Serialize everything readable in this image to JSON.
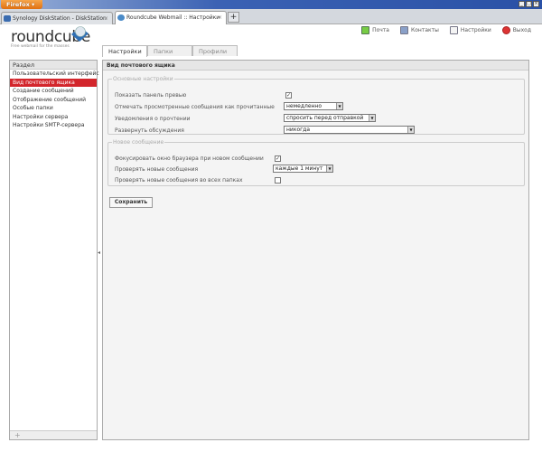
{
  "browser": {
    "menu_label": "Firefox",
    "tabs": [
      {
        "title": "Synology DiskStation - DiskStation"
      },
      {
        "title": "Roundcube Webmail :: Настройки"
      }
    ],
    "new_tab": "+"
  },
  "logo": {
    "name": "roundcube",
    "tagline": "Free webmail for the masses"
  },
  "topnav": [
    {
      "label": "Почта",
      "icon": "mail-icon"
    },
    {
      "label": "Контакты",
      "icon": "contacts-icon"
    },
    {
      "label": "Настройки",
      "icon": "settings-icon"
    },
    {
      "label": "Выход",
      "icon": "logout-icon"
    }
  ],
  "settings_tabs": [
    {
      "label": "Настройки",
      "active": true
    },
    {
      "label": "Папки"
    },
    {
      "label": "Профили"
    }
  ],
  "sections": {
    "header": "Раздел",
    "items": [
      "Пользовательский интерфейс",
      "Вид почтового ящика",
      "Создание сообщений",
      "Отображение сообщений",
      "Особые папки",
      "Настройки сервера",
      "Настройки SMTP-сервера"
    ],
    "selected": 1,
    "add": "+"
  },
  "main": {
    "title": "Вид почтового ящика",
    "group1": {
      "legend": "Основные настройки",
      "preview_label": "Показать панель превью",
      "preview_checked": true,
      "mark_read_label": "Отмечать просмотренные сообщения как прочитанные",
      "mark_read_value": "немедленно",
      "receipts_label": "Уведомления о прочтении",
      "receipts_value": "спросить перед отправкой",
      "threads_label": "Развернуть обсуждения",
      "threads_value": "никогда"
    },
    "group2": {
      "legend": "Новое сообщение",
      "focus_label": "Фокусировать окно браузера при новом сообщении",
      "focus_checked": true,
      "check_label": "Проверять новые сообщения",
      "check_value": "каждые 1 минут",
      "check_all_label": "Проверять новые сообщения во всех папках",
      "check_all_checked": false
    },
    "save": "Сохранить"
  }
}
